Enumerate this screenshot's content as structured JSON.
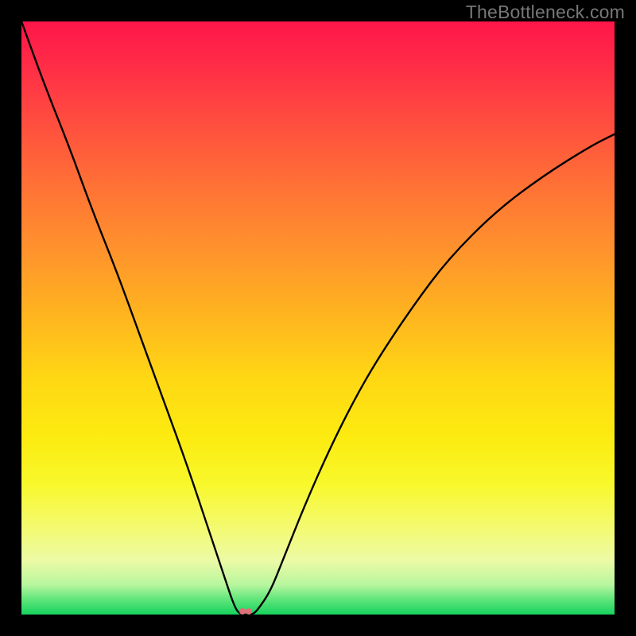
{
  "watermark": "TheBottleneck.com",
  "colors": {
    "frame": "#000000",
    "gradient_top": "#ff1649",
    "gradient_mid": "#ffd714",
    "gradient_bottom": "#17d35e",
    "curve": "#000000",
    "marker": "#e06f7a"
  },
  "chart_data": {
    "type": "line",
    "title": "",
    "xlabel": "",
    "ylabel": "",
    "xlim": [
      0,
      100
    ],
    "ylim": [
      0,
      100
    ],
    "grid": false,
    "legend": false,
    "series": [
      {
        "name": "bottleneck-curve",
        "x": [
          0,
          4,
          8,
          12,
          16,
          20,
          24,
          28,
          32,
          34,
          36,
          37,
          38,
          39,
          40,
          42,
          44,
          48,
          52,
          56,
          60,
          66,
          72,
          80,
          88,
          96,
          100
        ],
        "y": [
          100,
          89,
          79,
          68,
          58,
          47,
          36,
          25,
          13,
          7,
          1,
          0,
          0,
          0,
          1,
          4,
          9,
          19,
          28,
          36,
          43,
          52,
          60,
          68,
          74,
          79,
          81
        ]
      }
    ],
    "markers": [
      {
        "name": "vertex-marker-1",
        "x": 37.2,
        "y": 0.6
      },
      {
        "name": "vertex-marker-2",
        "x": 38.3,
        "y": 0.6
      }
    ],
    "notes": "V-shaped bottleneck curve; minimum near x≈37–38. Background is a vertical rainbow gradient from red (top, high bottleneck) to green (bottom, low bottleneck). No axis ticks or labels are rendered."
  }
}
